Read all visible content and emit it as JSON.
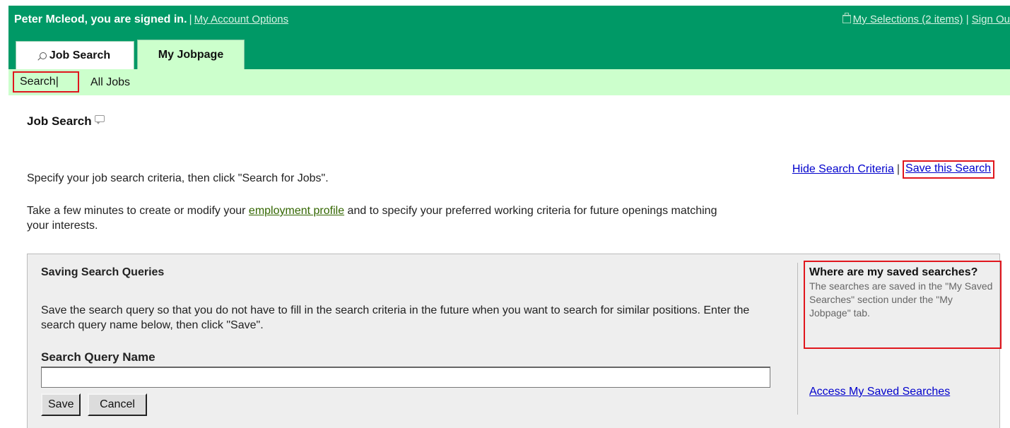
{
  "header": {
    "signed_in_text": "Peter Mcleod, you are signed in.",
    "separator": "|",
    "account_options": "My Account Options",
    "selections": "My Selections (2 items)",
    "sign_out": "Sign Ou"
  },
  "tabs": [
    {
      "label": "Job Search",
      "active": true
    },
    {
      "label": "My Jobpage",
      "active": false
    }
  ],
  "subnav": {
    "search": "Search|",
    "all_jobs": "All Jobs"
  },
  "page_title": "Job Search",
  "right_links": {
    "hide_criteria": "Hide Search Criteria",
    "pipe": "|",
    "save_search": "Save this Search"
  },
  "instructions": "Specify your job search criteria, then click \"Search for Jobs\".",
  "profile_note": {
    "before": "Take a few minutes to create or modify your ",
    "link": "employment profile",
    "after": " and to specify your preferred working criteria for future openings matching your interests."
  },
  "panel": {
    "title": "Saving Search Queries",
    "description": "Save the search query so that you do not have to fill in the search criteria in the future when you want to search for similar positions. Enter the search query name below, then click \"Save\".",
    "field_label": "Search Query Name",
    "input_value": "",
    "save_label": "Save",
    "cancel_label": "Cancel"
  },
  "help": {
    "title": "Where are my saved searches?",
    "text": "The searches are saved in the \"My Saved Searches\" section under the \"My Jobpage\" tab.",
    "access_link": "Access My Saved Searches"
  },
  "colors": {
    "header_green": "#009966",
    "light_green": "#ccffcc",
    "highlight_red": "#e0161d",
    "link_blue": "#0000cc"
  }
}
